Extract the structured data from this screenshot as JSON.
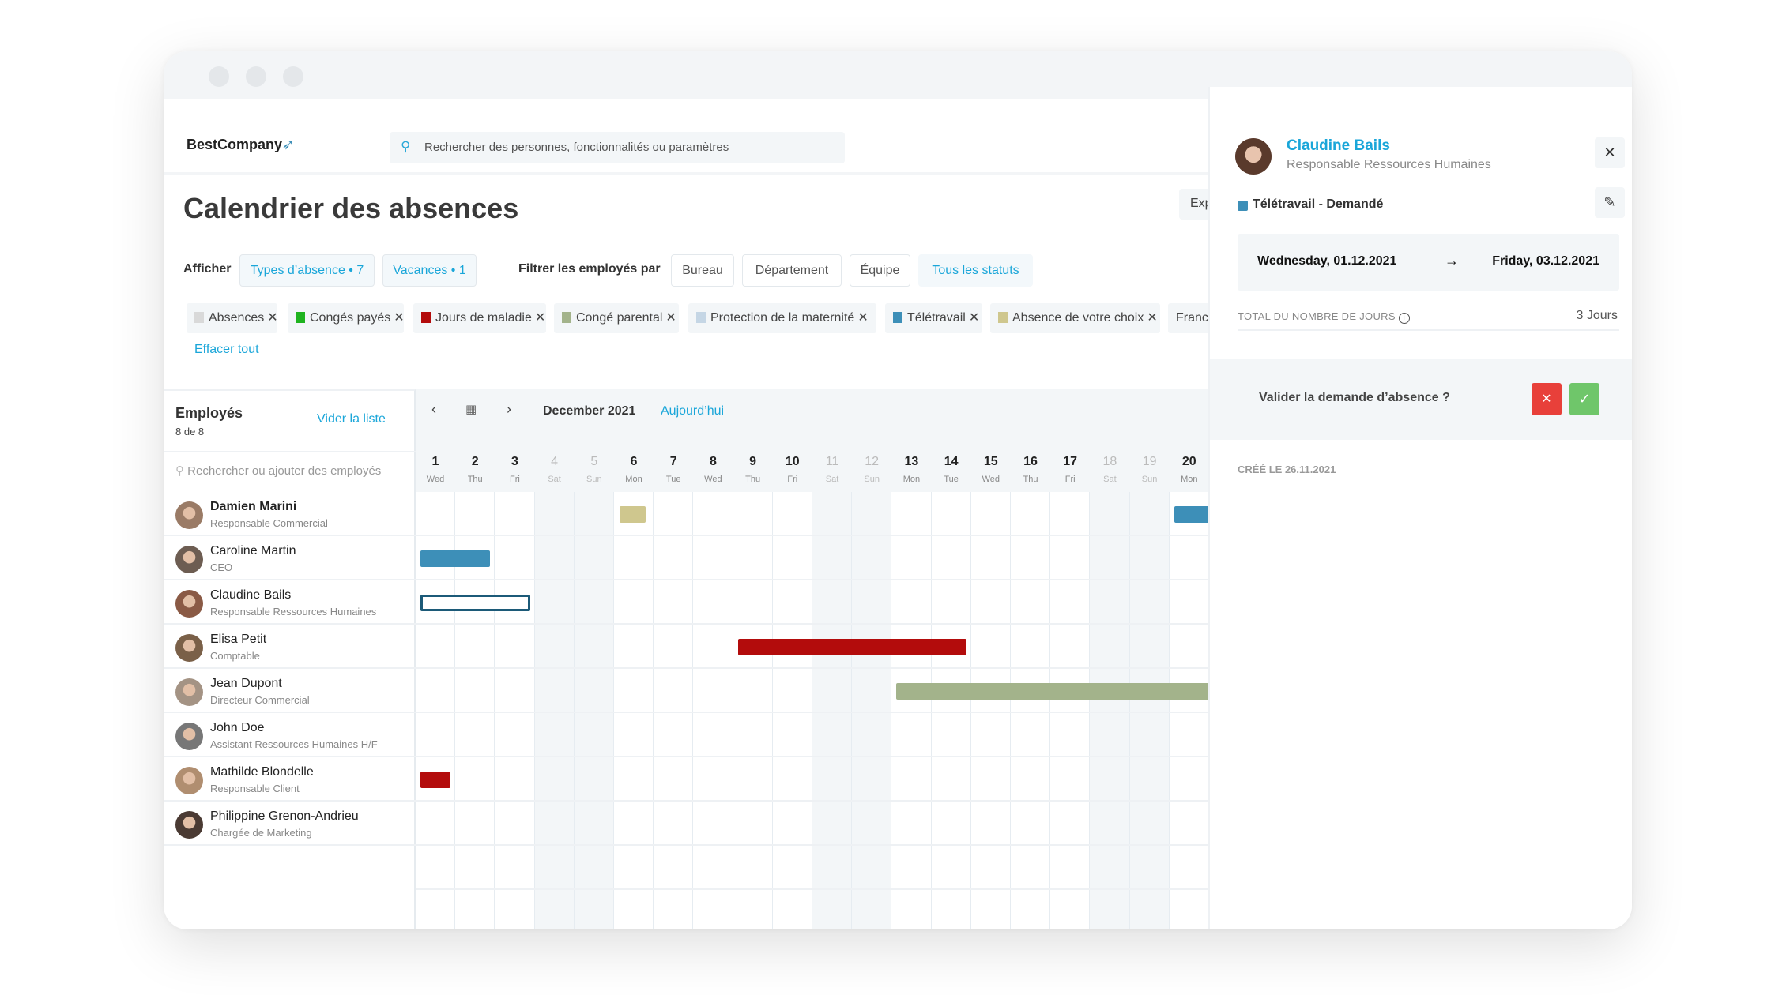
{
  "window": {
    "controls": [
      "close",
      "minimize",
      "maximize"
    ]
  },
  "header": {
    "logo": "BestCompany",
    "logo_icon": "rocket-icon",
    "search_placeholder": "Rechercher des personnes, fonctionnalités ou paramètres"
  },
  "page": {
    "title": "Calendrier des absences",
    "export_label": "Exp"
  },
  "filters": {
    "show_label": "Afficher",
    "absence_types": "Types d’absence • 7",
    "holidays": "Vacances • 1",
    "filter_label": "Filtrer les employés par",
    "office": "Bureau",
    "department": "Département",
    "team": "Équipe",
    "statuses": "Tous les statuts"
  },
  "chips": [
    {
      "label": "Absences",
      "color": "#d9d9d9"
    },
    {
      "label": "Congés payés",
      "color": "#1fb31f"
    },
    {
      "label": "Jours de maladie",
      "color": "#b30c0c"
    },
    {
      "label": "Congé parental",
      "color": "#a3b38b"
    },
    {
      "label": "Protection de la maternité",
      "color": "#c5d6e5"
    },
    {
      "label": "Télétravail",
      "color": "#3d8fb8"
    },
    {
      "label": "Absence de votre choix",
      "color": "#cfc78e"
    },
    {
      "label": "Franc",
      "color": ""
    }
  ],
  "clear_all": "Effacer tout",
  "employees_panel": {
    "title": "Employés",
    "count": "8 de 8",
    "clear_list": "Vider la liste",
    "search_placeholder": "Rechercher ou ajouter des employés"
  },
  "calendar": {
    "month": "December 2021",
    "today": "Aujourd’hui",
    "days": [
      {
        "n": "1",
        "w": "Wed"
      },
      {
        "n": "2",
        "w": "Thu"
      },
      {
        "n": "3",
        "w": "Fri"
      },
      {
        "n": "4",
        "w": "Sat",
        "weekend": true
      },
      {
        "n": "5",
        "w": "Sun",
        "weekend": true
      },
      {
        "n": "6",
        "w": "Mon"
      },
      {
        "n": "7",
        "w": "Tue"
      },
      {
        "n": "8",
        "w": "Wed"
      },
      {
        "n": "9",
        "w": "Thu"
      },
      {
        "n": "10",
        "w": "Fri"
      },
      {
        "n": "11",
        "w": "Sat",
        "weekend": true
      },
      {
        "n": "12",
        "w": "Sun",
        "weekend": true
      },
      {
        "n": "13",
        "w": "Mon"
      },
      {
        "n": "14",
        "w": "Tue"
      },
      {
        "n": "15",
        "w": "Wed"
      },
      {
        "n": "16",
        "w": "Thu"
      },
      {
        "n": "17",
        "w": "Fri"
      },
      {
        "n": "18",
        "w": "Sat",
        "weekend": true
      },
      {
        "n": "19",
        "w": "Sun",
        "weekend": true
      },
      {
        "n": "20",
        "w": "Mon"
      }
    ]
  },
  "employees": [
    {
      "name": "Damien Marini",
      "title": "Responsable Commercial",
      "bold": true,
      "avatar_color": "#9a7b66",
      "absences": [
        {
          "start": 6,
          "end": 6,
          "color": "#cfc78e",
          "partial": true
        },
        {
          "start": 20,
          "end": 21,
          "color": "#3d8fb8"
        }
      ]
    },
    {
      "name": "Caroline Martin",
      "title": "CEO",
      "avatar_color": "#6d5d52",
      "absences": [
        {
          "start": 1,
          "end": 2,
          "color": "#3d8fb8"
        }
      ]
    },
    {
      "name": "Claudine Bails",
      "title": "Responsable Ressources Humaines",
      "avatar_color": "#8a5a45",
      "absences": [
        {
          "start": 1,
          "end": 3,
          "color": "#1c5a78",
          "outline": true
        }
      ]
    },
    {
      "name": "Elisa Petit",
      "title": "Comptable",
      "avatar_color": "#7a6048",
      "absences": [
        {
          "start": 9,
          "end": 14,
          "color": "#b30c0c"
        }
      ]
    },
    {
      "name": "Jean Dupont",
      "title": "Directeur Commercial",
      "avatar_color": "#a49384",
      "absences": [
        {
          "start": 13,
          "end": 21,
          "color": "#a3b38b"
        }
      ]
    },
    {
      "name": "John Doe",
      "title": "Assistant Ressources Humaines H/F",
      "avatar_color": "#777",
      "absences": []
    },
    {
      "name": "Mathilde Blondelle",
      "title": "Responsable Client",
      "avatar_color": "#b08e70",
      "absences": [
        {
          "start": 1,
          "end": 1,
          "color": "#b30c0c"
        }
      ]
    },
    {
      "name": "Philippine Grenon-Andrieu",
      "title": "Chargée de Marketing",
      "avatar_color": "#4a3a33",
      "absences": []
    }
  ],
  "detail": {
    "name": "Claudine Bails",
    "title": "Responsable Ressources Humaines",
    "type": "Télétravail - Demandé",
    "type_color": "#3d8fb8",
    "from": "Wednesday, 01.12.2021",
    "arrow": "→",
    "to": "Friday, 03.12.2021",
    "total_label": "TOTAL DU NOMBRE DE JOURS",
    "total_value": "3 Jours",
    "validate_question": "Valider la demande d’absence ?",
    "reject": "✕",
    "approve": "✓",
    "created": "CRÉÉ LE 26.11.2021",
    "colors": {
      "accent": "#1aa6d9",
      "reject": "#e8403a",
      "approve": "#6fc66a"
    }
  }
}
